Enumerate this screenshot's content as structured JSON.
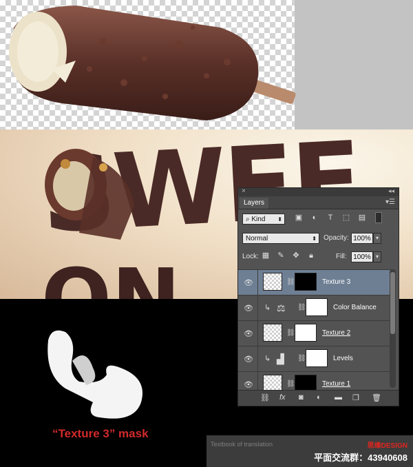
{
  "panel": {
    "tab": "Layers",
    "filter": {
      "kind_label": "Kind",
      "icons": [
        "image-filter-icon",
        "adjustment-filter-icon",
        "type-filter-icon",
        "shape-filter-icon",
        "smart-object-filter-icon"
      ],
      "type_glyph": "T"
    },
    "blend_mode": "Normal",
    "opacity_label": "Opacity:",
    "opacity_value": "100%",
    "lock_label": "Lock:",
    "fill_label": "Fill:",
    "fill_value": "100%",
    "layers": [
      {
        "name": "Texture 3",
        "selected": true
      },
      {
        "name": "Color Balance",
        "selected": false
      },
      {
        "name": "Texture 2",
        "selected": false
      },
      {
        "name": "Levels",
        "selected": false
      },
      {
        "name": "Texture 1",
        "selected": false
      }
    ],
    "bottom_icons": [
      "link-layers-icon",
      "fx-icon",
      "add-mask-icon",
      "new-adjustment-icon",
      "new-group-icon",
      "new-layer-icon",
      "delete-layer-icon"
    ],
    "fx_glyph": "fx"
  },
  "artwork": {
    "headline_top": "SWEE",
    "headline_bottom": "ON"
  },
  "caption": "“Texture 3” mask",
  "watermark": {
    "left_text": "Textbook of translation",
    "brand": "思缘DESIGN",
    "group": "平面交流群：43940608"
  },
  "colors": {
    "panel_bg": "#535353",
    "selected_row": "#6e7f94",
    "caption_red": "#d22a2a",
    "chocolate": "#4a2a26"
  }
}
